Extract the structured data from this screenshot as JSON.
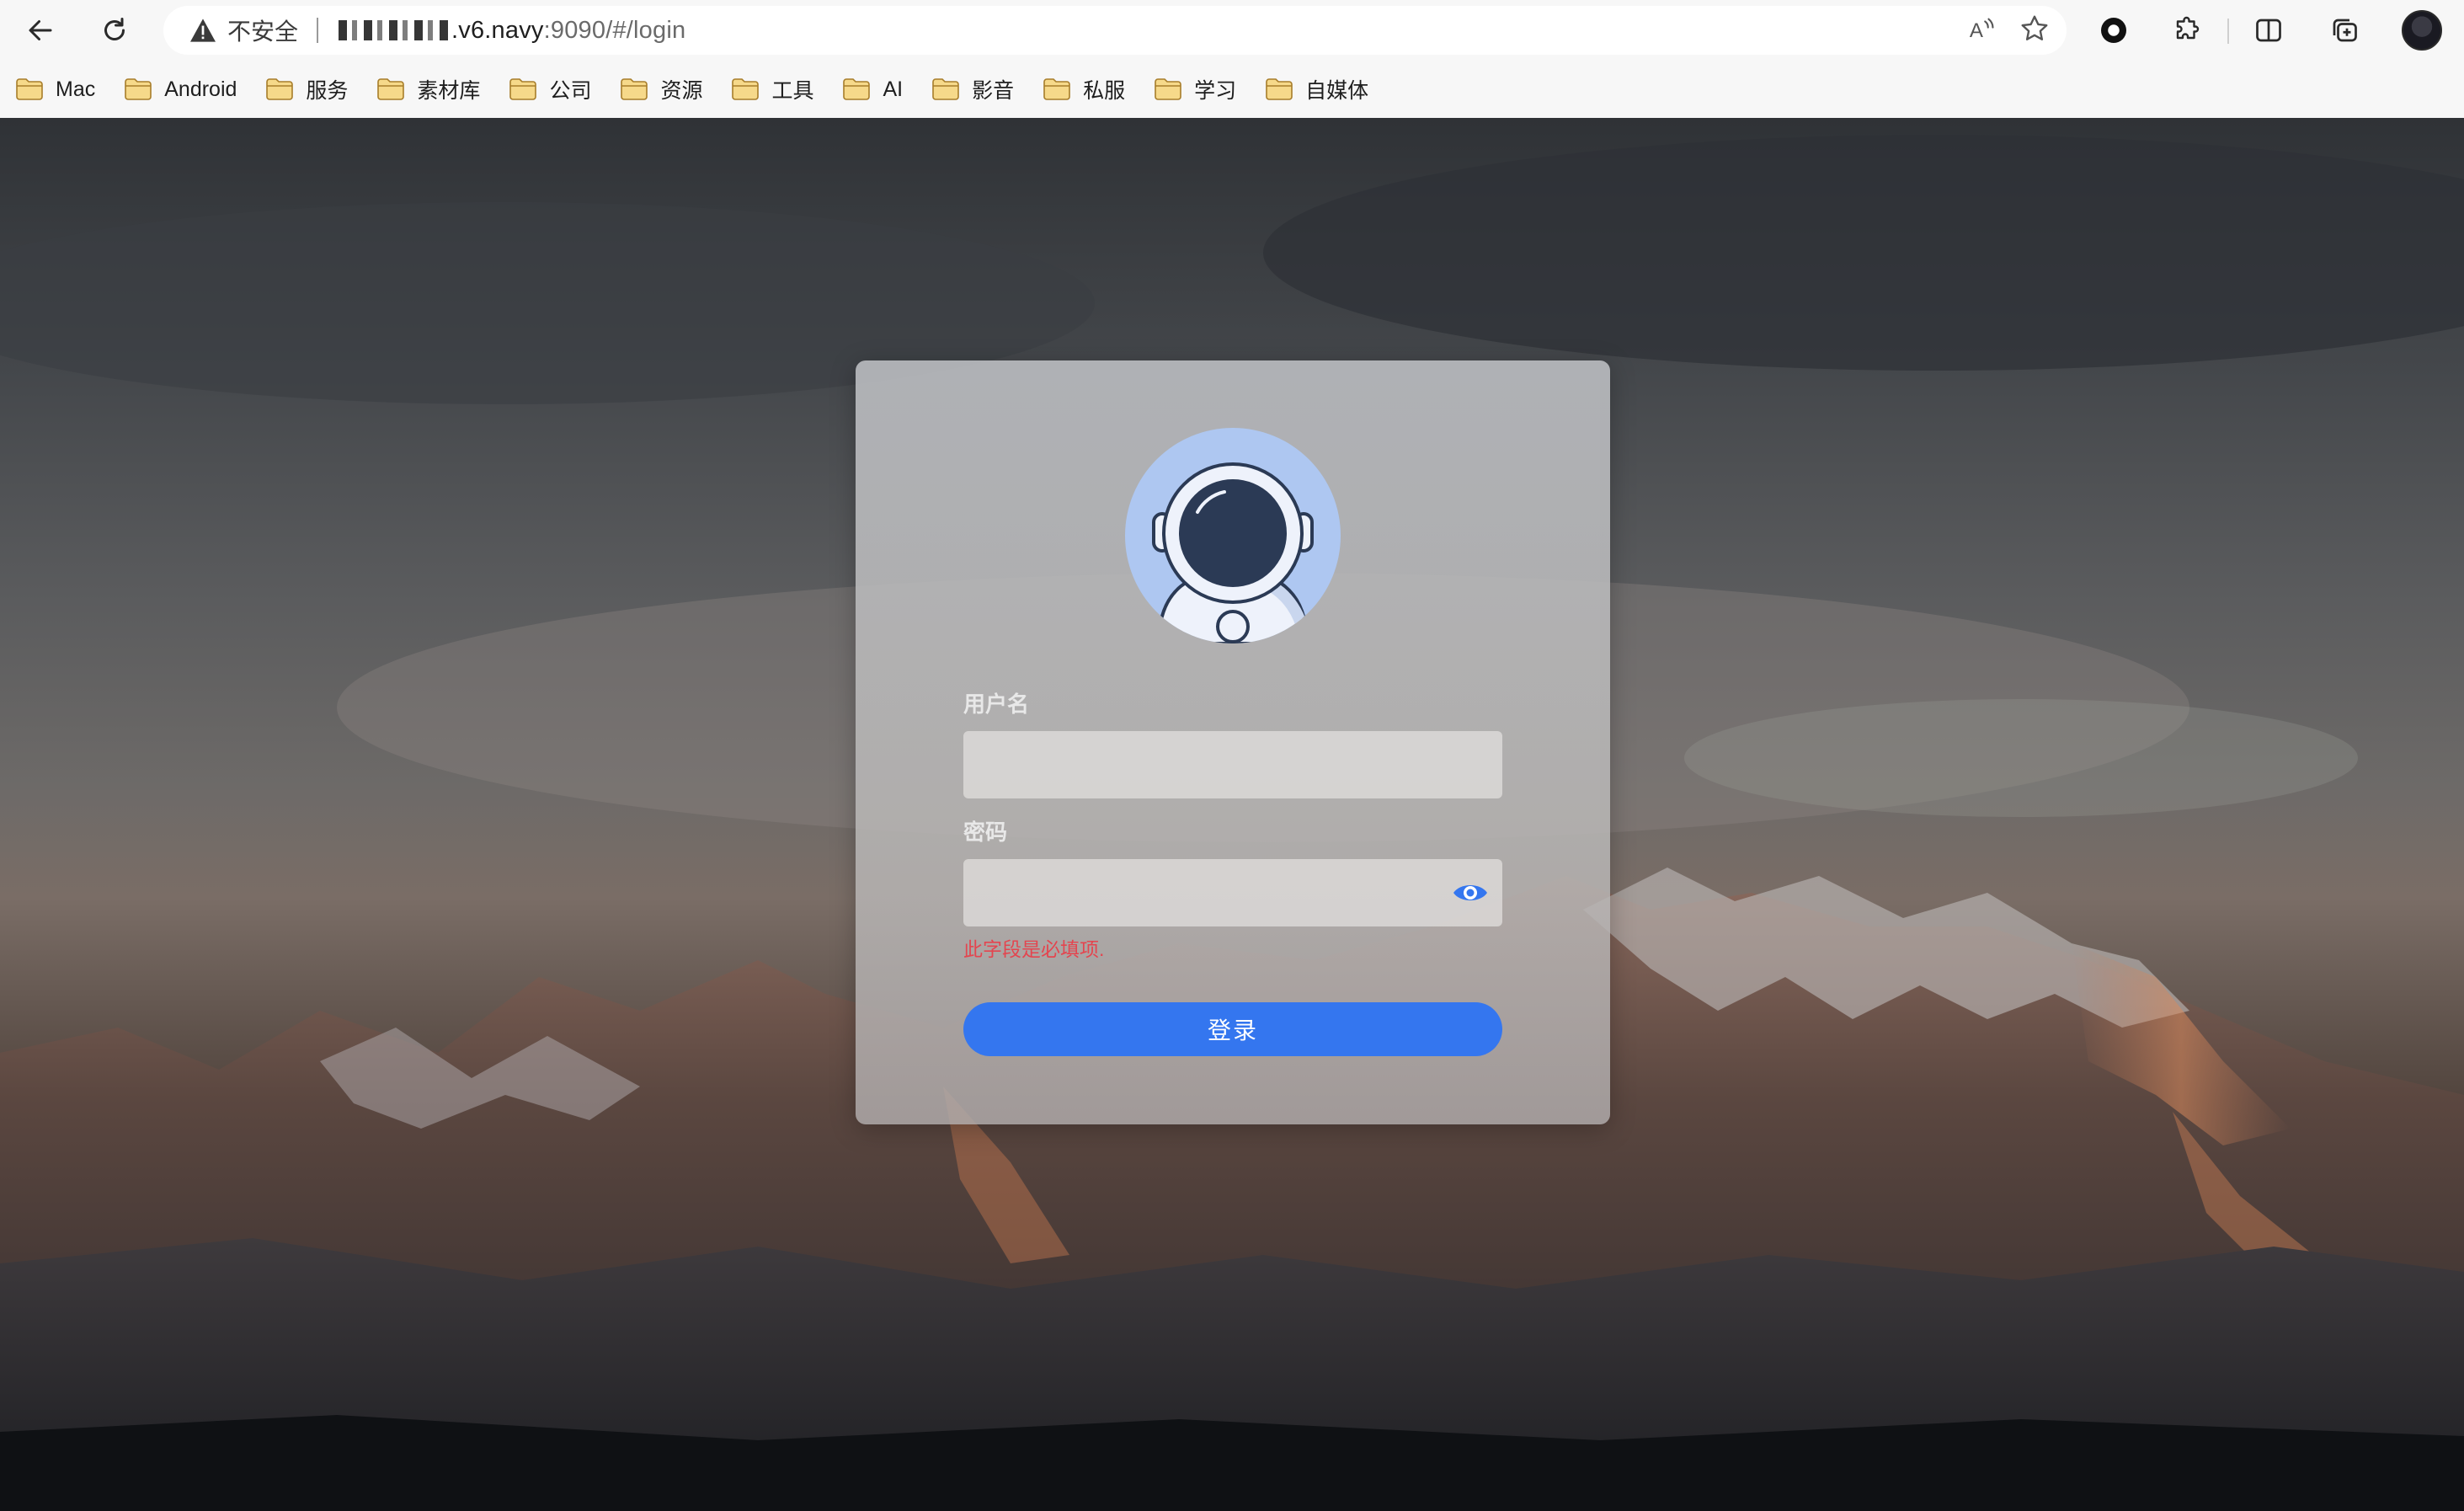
{
  "browser": {
    "back_icon": "arrow-left-icon",
    "reload_icon": "reload-icon",
    "security_icon": "warning-triangle-icon",
    "security_text": "不安全",
    "url_host": ".v6.navy",
    "url_rest": ":9090/#/login",
    "read_aloud_icon": "read-aloud-icon",
    "favorite_icon": "star-icon",
    "extension_icons": [
      "record-extension-icon",
      "puzzle-extension-icon"
    ],
    "split_icon": "split-screen-icon",
    "collections_icon": "collections-icon",
    "profile_icon": "profile-avatar"
  },
  "bookmarks": [
    {
      "label": "Mac"
    },
    {
      "label": "Android"
    },
    {
      "label": "服务"
    },
    {
      "label": "素材库"
    },
    {
      "label": "公司"
    },
    {
      "label": "资源"
    },
    {
      "label": "工具"
    },
    {
      "label": "AI"
    },
    {
      "label": "影音"
    },
    {
      "label": "私服"
    },
    {
      "label": "学习"
    },
    {
      "label": "自媒体"
    }
  ],
  "login": {
    "avatar_icon": "astronaut-avatar",
    "username_label": "用户名",
    "username_value": "",
    "password_label": "密码",
    "password_value": "",
    "password_toggle_icon": "eye-icon",
    "password_error": "此字段是必填项.",
    "submit_label": "登录"
  },
  "colors": {
    "accent": "#3476ef",
    "error": "#e4454f",
    "avatar_bg": "#aec7f1"
  }
}
